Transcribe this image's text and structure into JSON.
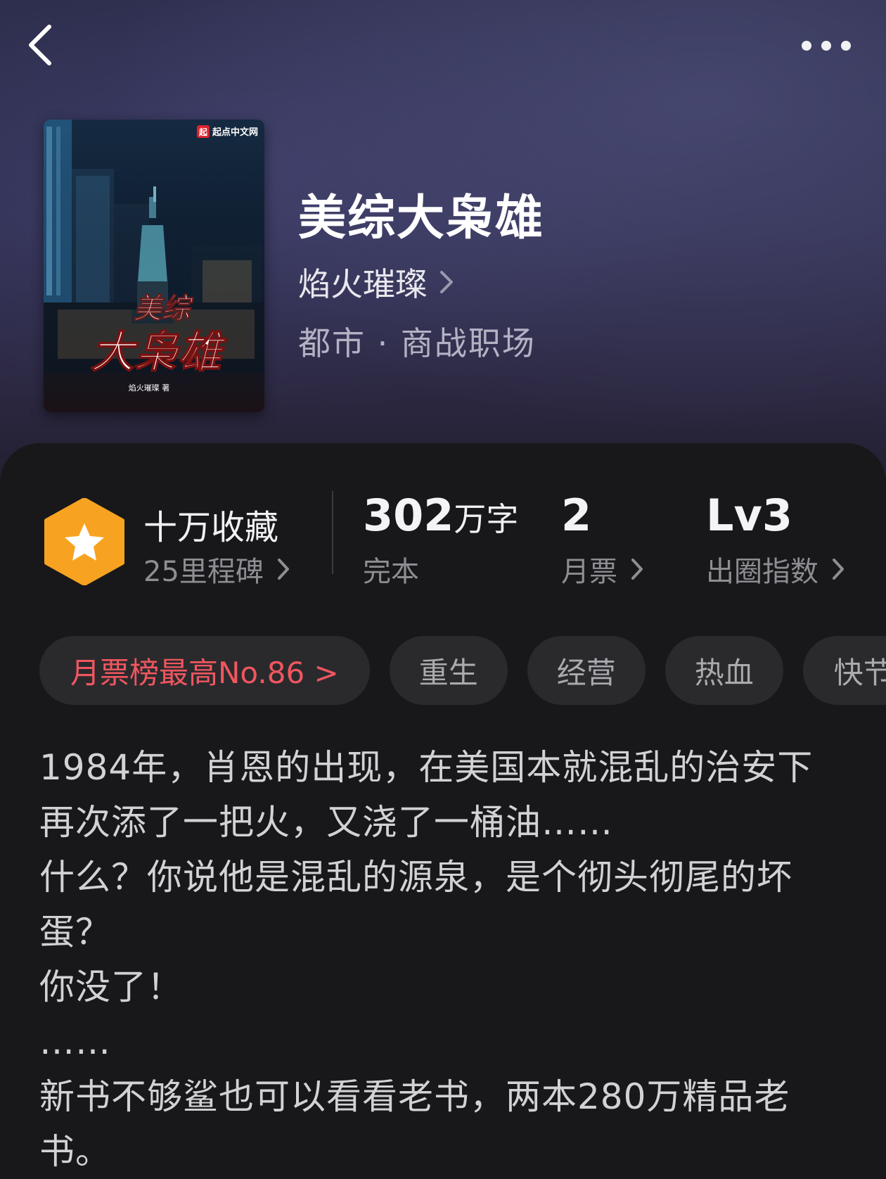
{
  "header": {
    "back_icon": "chevron-left-icon",
    "more_icon": "more-horizontal-icon"
  },
  "book": {
    "cover": {
      "publisher_logo_text": "起点中文网",
      "cover_title_line1": "美综",
      "cover_title_line2": "大枭雄",
      "cover_author": "焰火璀璨 著"
    },
    "title": "美综大枭雄",
    "author": "焰火璀璨",
    "genre": "都市 · 商战职场"
  },
  "stats": {
    "collection": {
      "title": "十万收藏",
      "subtitle": "25里程碑"
    },
    "words": {
      "value": "302",
      "unit": "万字",
      "label": "完本"
    },
    "monthly_votes": {
      "value": "2",
      "label": "月票"
    },
    "influence": {
      "value": "Lv3",
      "label": "出圈指数"
    }
  },
  "tags": [
    {
      "label": "月票榜最高No.86 >",
      "style": "highlight"
    },
    {
      "label": "重生"
    },
    {
      "label": "经营"
    },
    {
      "label": "热血"
    },
    {
      "label": "快节奏"
    }
  ],
  "description": [
    "1984年，肖恩的出现，在美国本就混乱的治安下再次添了一把火，又浇了一桶油……",
    "什么？你说他是混乱的源泉，是个彻头彻尾的坏蛋？",
    "你没了！",
    "……",
    "新书不够鲨也可以看看老书，两本280万精品老书。"
  ],
  "colors": {
    "highlight_red": "#f0565f",
    "badge_orange": "#f7a321",
    "panel_bg": "#18181a"
  }
}
